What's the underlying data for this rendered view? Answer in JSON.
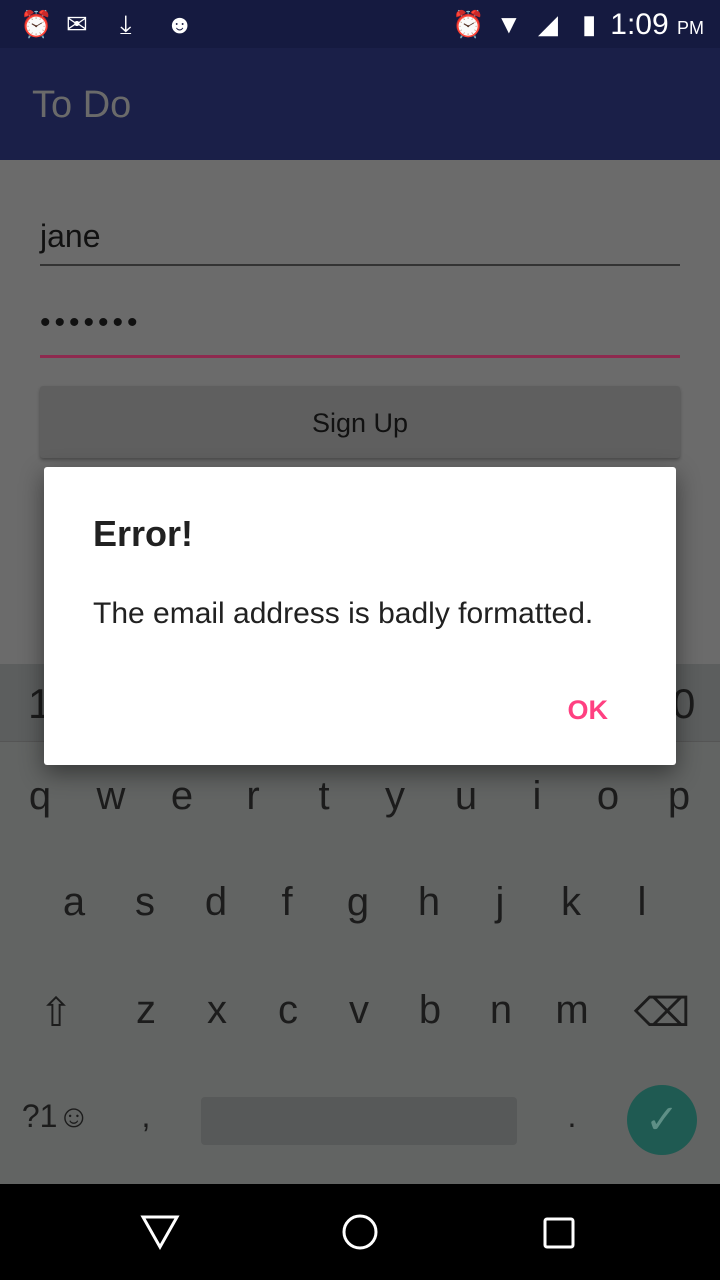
{
  "status_bar": {
    "time": "1:09",
    "ampm": "PM",
    "left_icons": [
      "alarm-icon",
      "gmail-icon",
      "download-icon",
      "android-icon"
    ],
    "right_icons": [
      "alarm-icon",
      "wifi-icon",
      "signal-icon",
      "battery-charging-icon"
    ]
  },
  "app_bar": {
    "title": "To Do"
  },
  "form": {
    "username": "jane",
    "password": "•••••••",
    "signup_label": "Sign Up"
  },
  "dialog": {
    "title": "Error!",
    "message": "The email address is badly formatted.",
    "ok_label": "OK"
  },
  "keyboard": {
    "number_row_visible": [
      "1",
      "0"
    ],
    "row1": [
      "q",
      "w",
      "e",
      "r",
      "t",
      "y",
      "u",
      "i",
      "o",
      "p"
    ],
    "row2": [
      "a",
      "s",
      "d",
      "f",
      "g",
      "h",
      "j",
      "k",
      "l"
    ],
    "row3": [
      "z",
      "x",
      "c",
      "v",
      "b",
      "n",
      "m"
    ],
    "symbols_label": "?1☺",
    "comma": ",",
    "period": "."
  },
  "colors": {
    "accent": "#ff4081",
    "primary_dark": "#151a40",
    "primary": "#1a1f48"
  }
}
